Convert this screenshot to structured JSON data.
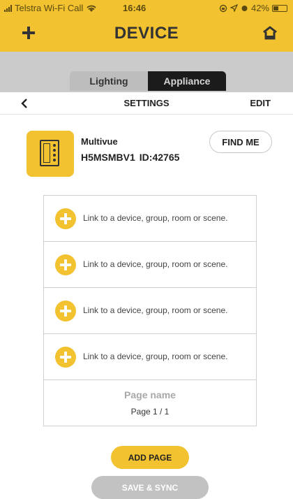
{
  "status_bar": {
    "carrier": "Telstra Wi-Fi Call",
    "time": "16:46",
    "battery": "42%",
    "battery_level": 0.42
  },
  "nav": {
    "title": "DEVICE",
    "left_icon": "plus-icon",
    "right_icon": "home-icon"
  },
  "tabs": [
    {
      "label": "Lighting",
      "selected": false
    },
    {
      "label": "Appliance",
      "selected": true
    }
  ],
  "settings_bar": {
    "title": "SETTINGS",
    "edit_label": "EDIT",
    "back_icon": "chevron-left-icon"
  },
  "device": {
    "name": "Multivue",
    "model": "H5MSMBV1",
    "id": "ID:42765",
    "find_me_label": "FIND ME"
  },
  "links": [
    {
      "label": "Link to a device, group, room or scene."
    },
    {
      "label": "Link to a device, group, room or scene."
    },
    {
      "label": "Link to a device, group, room or scene."
    },
    {
      "label": "Link to a device, group, room or scene."
    }
  ],
  "page": {
    "name_placeholder": "Page name",
    "number": "Page 1 / 1"
  },
  "buttons": {
    "add_page": "ADD PAGE",
    "save_sync": "SAVE & SYNC"
  },
  "colors": {
    "accent": "#f2c230",
    "segment_active": "#1b1b1b",
    "disabled_button": "#c2c2c2"
  }
}
